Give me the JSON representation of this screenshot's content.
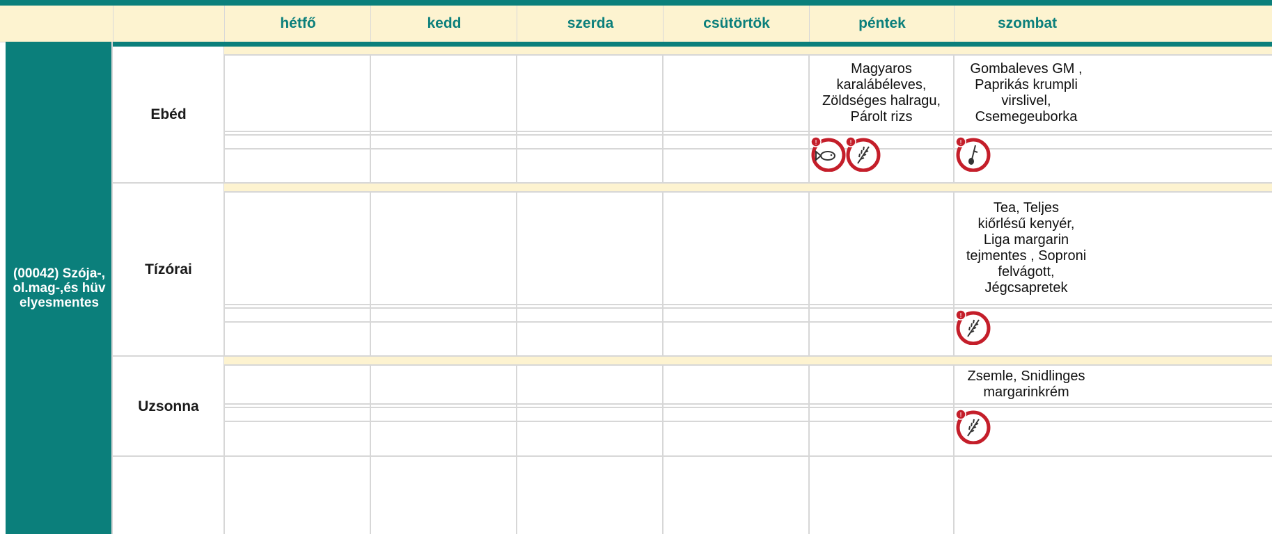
{
  "header": {
    "days": [
      "hétfő",
      "kedd",
      "szerda",
      "csütörtök",
      "péntek",
      "szombat"
    ]
  },
  "diet": {
    "label": "(00042) Szója-,ol.mag-,és hüvelyesmentes"
  },
  "meals": [
    {
      "name": "Ebéd",
      "pentek": "Magyaros\nkaralábéleves,\nZöldséges halragu,\nPárolt rizs",
      "szombat": "Gombaleves GM ,\nPaprikás krumpli\nvirslivel,\nCsemegeuborka",
      "pentek_allergens": [
        "fish-allergen-icon",
        "gluten-allergen-icon"
      ],
      "szombat_allergens": [
        "whisk-allergen-icon"
      ]
    },
    {
      "name": "Tízórai",
      "szombat": "Tea, Teljes\nkiőrlésű kenyér,\nLiga margarin\ntejmentes , Soproni\nfelvágott,\nJégcsapretek",
      "szombat_allergens": [
        "gluten-allergen-icon"
      ]
    },
    {
      "name": "Uzsonna",
      "szombat": "Zsemle, Snidlinges\nmargarinkrém",
      "szombat_allergens": [
        "gluten-allergen-icon"
      ]
    }
  ],
  "colors": {
    "accent": "#0b7f7b",
    "cream": "#fdf3d0",
    "allergen_red": "#c41e2a",
    "grid": "#d7d7d7"
  }
}
